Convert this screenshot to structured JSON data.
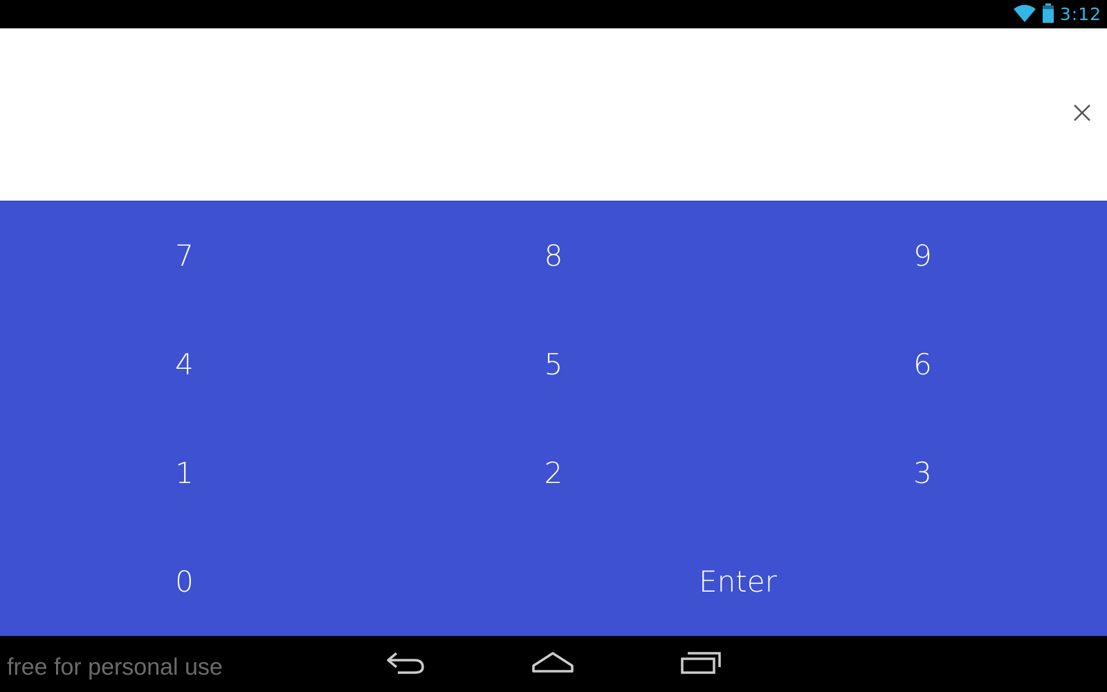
{
  "status_bar": {
    "time": "3:12",
    "icons": [
      "wifi-icon",
      "battery-icon"
    ],
    "accent_color": "#33b5e5"
  },
  "display": {
    "value": "",
    "clear_icon": "close-icon"
  },
  "keypad": {
    "background_color": "#3d51d1",
    "keys": {
      "k7": "7",
      "k8": "8",
      "k9": "9",
      "k4": "4",
      "k5": "5",
      "k6": "6",
      "k1": "1",
      "k2": "2",
      "k3": "3",
      "k0": "0",
      "enter": "Enter"
    }
  },
  "nav_bar": {
    "watermark": "free for personal use",
    "buttons": [
      "back-icon",
      "home-icon",
      "recent-apps-icon"
    ]
  }
}
